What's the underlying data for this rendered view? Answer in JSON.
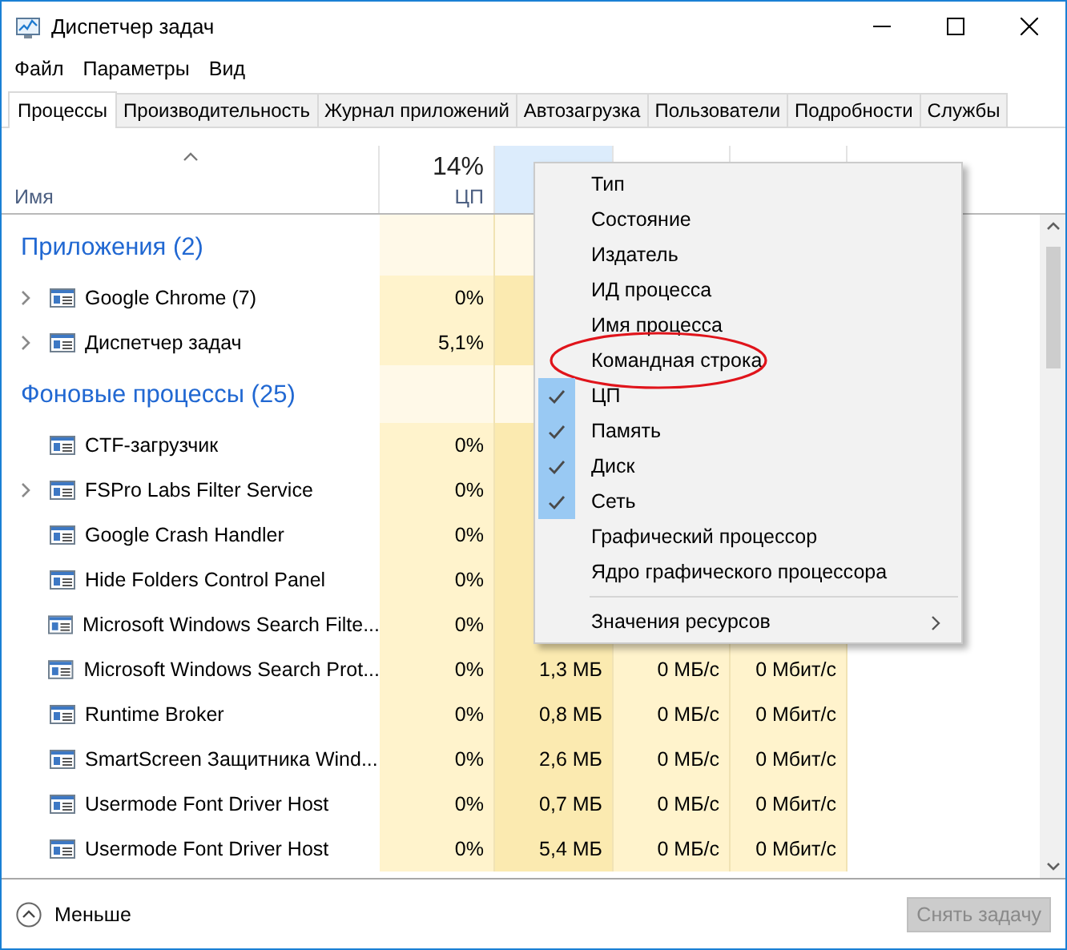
{
  "window": {
    "title": "Диспетчер задач"
  },
  "menu_bar": [
    "Файл",
    "Параметры",
    "Вид"
  ],
  "tabs": [
    {
      "label": "Процессы",
      "selected": true
    },
    {
      "label": "Производительность",
      "selected": false
    },
    {
      "label": "Журнал приложений",
      "selected": false
    },
    {
      "label": "Автозагрузка",
      "selected": false
    },
    {
      "label": "Пользователи",
      "selected": false
    },
    {
      "label": "Подробности",
      "selected": false
    },
    {
      "label": "Службы",
      "selected": false
    }
  ],
  "columns": [
    {
      "label": "Имя",
      "sorted": true,
      "highlighted": false
    },
    {
      "label": "ЦП",
      "reading": "14%",
      "sorted": false,
      "highlighted": false
    },
    {
      "sorted": false,
      "highlighted": true
    },
    {
      "sorted": false,
      "highlighted": false
    },
    {
      "sorted": false,
      "highlighted": false
    }
  ],
  "groups": [
    {
      "title": "Приложения (2)",
      "rows": [
        {
          "name": "Google Chrome (7)",
          "expandable": true,
          "cpu": "0%"
        },
        {
          "name": "Диспетчер задач",
          "expandable": true,
          "cpu": "5,1%"
        }
      ]
    },
    {
      "title": "Фоновые процессы (25)",
      "rows": [
        {
          "name": "CTF-загрузчик",
          "expandable": false,
          "cpu": "0%"
        },
        {
          "name": "FSPro Labs Filter Service",
          "expandable": true,
          "cpu": "0%"
        },
        {
          "name": "Google Crash Handler",
          "expandable": false,
          "cpu": "0%"
        },
        {
          "name": "Hide Folders Control Panel",
          "expandable": false,
          "cpu": "0%"
        },
        {
          "name": "Microsoft Windows Search Filte...",
          "expandable": false,
          "cpu": "0%"
        },
        {
          "name": "Microsoft Windows Search Prot...",
          "expandable": false,
          "cpu": "0%",
          "memory": "1,3 МБ",
          "disk": "0 МБ/с",
          "network": "0 Мбит/с"
        },
        {
          "name": "Runtime Broker",
          "expandable": false,
          "cpu": "0%",
          "memory": "0,8 МБ",
          "disk": "0 МБ/с",
          "network": "0 Мбит/с"
        },
        {
          "name": "SmartScreen Защитника Wind...",
          "expandable": false,
          "cpu": "0%",
          "memory": "2,6 МБ",
          "disk": "0 МБ/с",
          "network": "0 Мбит/с"
        },
        {
          "name": "Usermode Font Driver Host",
          "expandable": false,
          "cpu": "0%",
          "memory": "0,7 МБ",
          "disk": "0 МБ/с",
          "network": "0 Мбит/с"
        },
        {
          "name": "Usermode Font Driver Host",
          "expandable": false,
          "cpu": "0%",
          "memory": "5,4 МБ",
          "disk": "0 МБ/с",
          "network": "0 Мбит/с"
        }
      ]
    }
  ],
  "context_menu": [
    {
      "kind": "item",
      "label": "Тип",
      "checked": false,
      "highlighted": false
    },
    {
      "kind": "item",
      "label": "Состояние",
      "checked": false,
      "highlighted": false
    },
    {
      "kind": "item",
      "label": "Издатель",
      "checked": false,
      "highlighted": false
    },
    {
      "kind": "item",
      "label": "ИД процесса",
      "checked": false,
      "highlighted": false
    },
    {
      "kind": "item",
      "label": "Имя процесса",
      "checked": false,
      "highlighted": false
    },
    {
      "kind": "item",
      "label": "Командная строка",
      "checked": false,
      "highlighted": true
    },
    {
      "kind": "item",
      "label": "ЦП",
      "checked": true,
      "highlighted": false
    },
    {
      "kind": "item",
      "label": "Память",
      "checked": true,
      "highlighted": false
    },
    {
      "kind": "item",
      "label": "Диск",
      "checked": true,
      "highlighted": false
    },
    {
      "kind": "item",
      "label": "Сеть",
      "checked": true,
      "highlighted": false
    },
    {
      "kind": "item",
      "label": "Графический процессор",
      "checked": false,
      "highlighted": false
    },
    {
      "kind": "item",
      "label": "Ядро графического процессора",
      "checked": false,
      "highlighted": false
    },
    {
      "kind": "separator"
    },
    {
      "kind": "submenu",
      "label": "Значения ресурсов"
    }
  ],
  "footer": {
    "toggle": "Меньше",
    "end_task": {
      "label": "Снять задачу",
      "disabled": true
    }
  }
}
